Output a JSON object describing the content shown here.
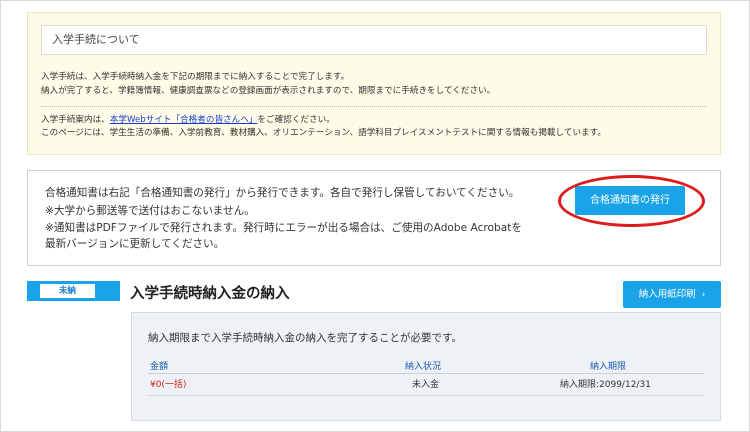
{
  "notice": {
    "title": "入学手続について",
    "p1": "入学手続は、入学手続時納入金を下記の期限までに納入することで完了します。",
    "p2": "納入が完了すると、学籍簿情報、健康調査票などの登録画面が表示されますので、期限までに手続きをしてください。",
    "p3_before": "入学手続案内は、",
    "p3_link": "本学Webサイト「合格者の皆さんへ」",
    "p3_after": "をご確認ください。",
    "p4": "このページには、学生生活の準備、入学前教育、教材購入、オリエンテーション、語学科目プレイスメントテストに関する情報も掲載しています。"
  },
  "certificate": {
    "line1": "合格通知書は右記「合格通知書の発行」から発行できます。各自で発行し保管しておいてください。",
    "line2": "※大学から郵送等で送付はおこないません。",
    "line3": "※通知書はPDFファイルで発行されます。発行時にエラーが出る場合は、ご使用のAdobe Acrobatを",
    "line4": "最新バージョンに更新してください。",
    "button_label": "合格通知書の発行"
  },
  "payment": {
    "status_badge": "未納",
    "title": "入学手続時納入金の納入",
    "print_button_label": "納入用紙印刷",
    "print_button_chevron": "›",
    "message": "納入期限まで入学手続時納入金の納入を完了することが必要です。",
    "columns": {
      "amount": "金額",
      "status": "納入状況",
      "deadline": "納入期限"
    },
    "row": {
      "amount": "¥0(一括)",
      "status": "未入金",
      "deadline": "納入期限:2099/12/31"
    }
  },
  "colors": {
    "accent": "#1aa3e8",
    "highlight_ring": "#e01b1b",
    "notice_bg": "#fefce8",
    "amount_red": "#d52020"
  }
}
